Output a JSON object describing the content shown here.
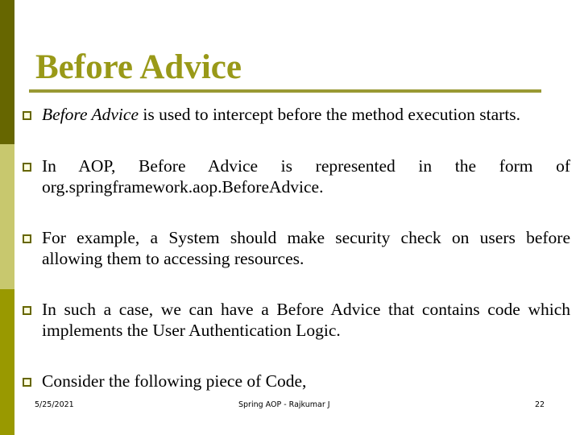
{
  "slide": {
    "title": "Before Advice",
    "bullets": [
      {
        "emphasis": "Before Advice",
        "text": " is used to intercept before the method execution starts."
      },
      {
        "text": "In AOP, Before Advice is represented in the form of org.springframework.aop.BeforeAdvice."
      },
      {
        "text": "For example, a System should make security check on users before allowing them to accessing resources."
      },
      {
        "text": "In such a case, we can have a Before Advice that contains code which implements the User Authentication Logic."
      },
      {
        "text": "Consider the following piece of Code,"
      }
    ],
    "bullet_icon": "hollow-square-bullet"
  },
  "footer": {
    "date": "5/25/2021",
    "center": "Spring AOP  - Rajkumar J",
    "page_number": "22"
  },
  "colors": {
    "title": "#999918",
    "bar_top": "#666600",
    "bar_middle": "#c8c86e",
    "bar_bottom": "#999900",
    "rule": "#999933"
  }
}
